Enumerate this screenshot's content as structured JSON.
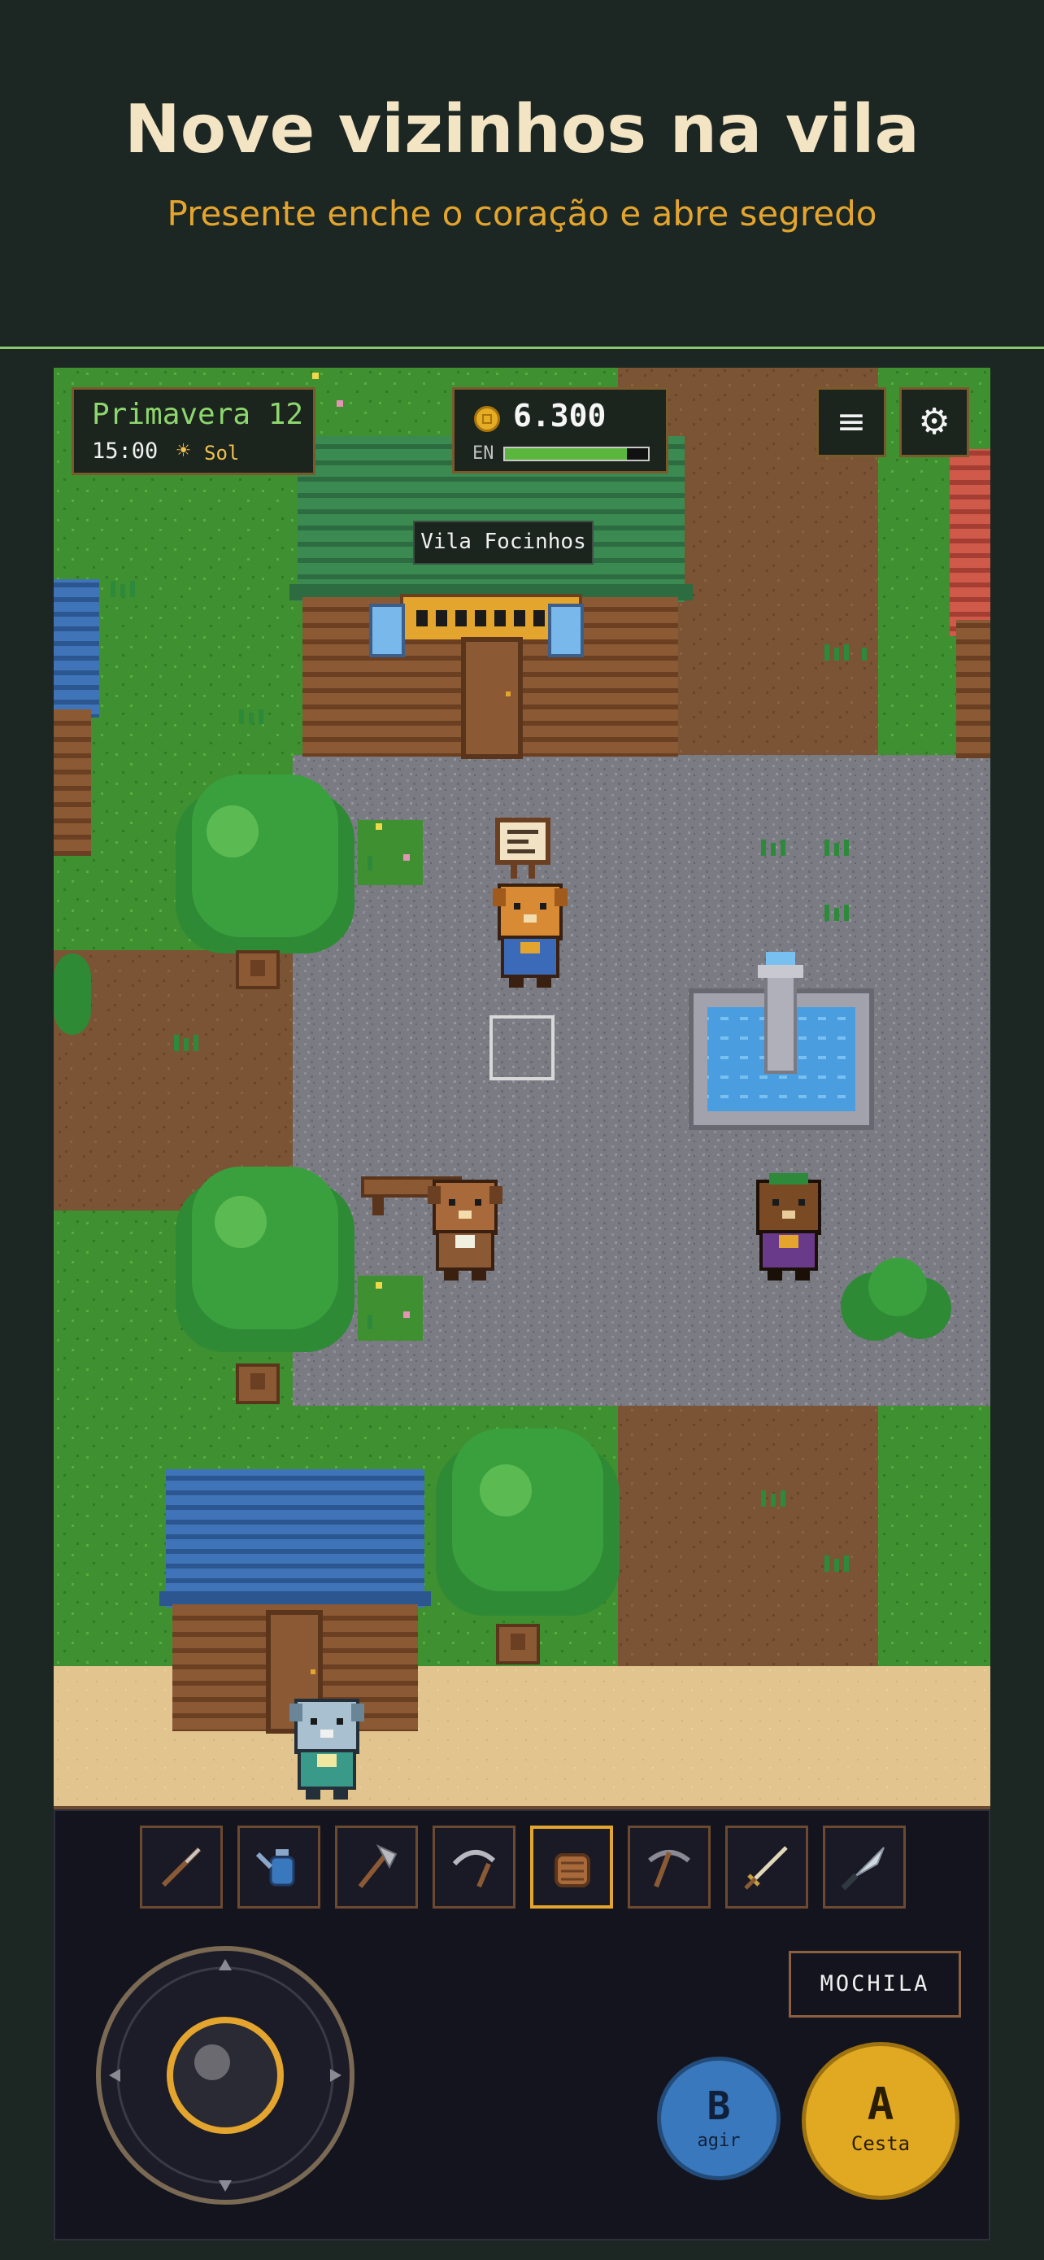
{
  "header": {
    "title": "Nove vizinhos na vila",
    "subtitle": "Presente enche o coração e abre segredo"
  },
  "hud": {
    "date": "Primavera 12",
    "time": "15:00",
    "weather_icon": "sun-icon",
    "weather": "Sol",
    "money": "6.300",
    "energy_label": "EN",
    "energy_level": 0.85,
    "menu_icon": "≡",
    "settings_icon": "⚙"
  },
  "map": {
    "location_name": "Vila Focinhos"
  },
  "toolbar": {
    "selected_index": 4,
    "tools": [
      {
        "name": "fishing-rod-icon"
      },
      {
        "name": "watering-can-icon"
      },
      {
        "name": "axe-icon"
      },
      {
        "name": "sickle-icon"
      },
      {
        "name": "basket-icon"
      },
      {
        "name": "pickaxe-icon"
      },
      {
        "name": "sword-icon"
      },
      {
        "name": "knife-icon"
      }
    ]
  },
  "controls": {
    "backpack_label": "MOCHILA",
    "b_label": "B",
    "b_sub": "agir",
    "a_label": "A",
    "a_sub": "Cesta"
  },
  "colors": {
    "accent": "#e3a52e",
    "grass": "#3a8c2c",
    "panel": "#1b241d"
  }
}
